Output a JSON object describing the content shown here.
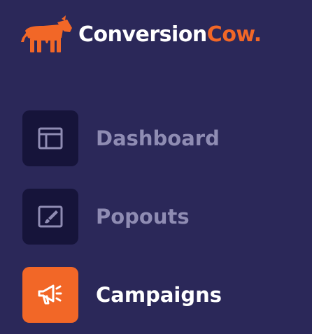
{
  "brand": {
    "name_part1": "Conversion",
    "name_part2": "Cow.",
    "logo_icon": "cow-icon",
    "colors": {
      "white": "#ffffff",
      "orange": "#f26727"
    }
  },
  "theme": {
    "background": "#2b2859",
    "icon_box_bg": "#16143a",
    "active_bg": "#f26727",
    "inactive_label": "#8f8cb3",
    "active_label": "#ffffff"
  },
  "nav": {
    "items": [
      {
        "label": "Dashboard",
        "icon": "layout-icon",
        "active": false
      },
      {
        "label": "Popouts",
        "icon": "brush-icon",
        "active": false
      },
      {
        "label": "Campaigns",
        "icon": "megaphone-icon",
        "active": true
      }
    ]
  }
}
